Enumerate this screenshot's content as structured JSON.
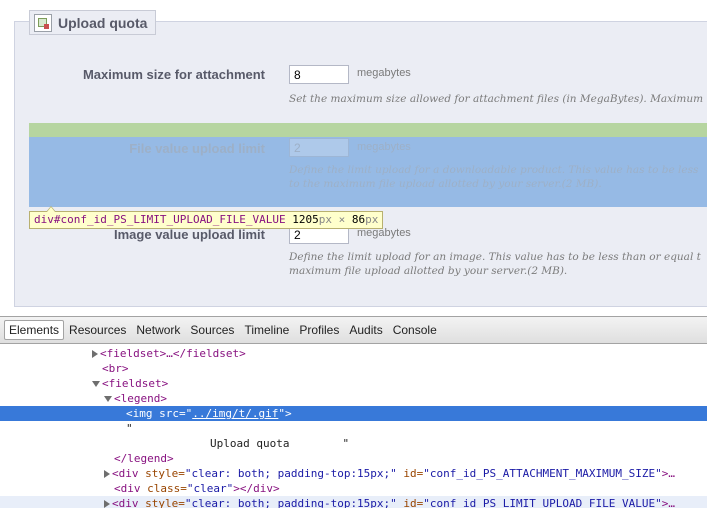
{
  "page": {
    "fieldset_legend": "Upload quota",
    "rows": [
      {
        "label": "Maximum size for attachment",
        "value": "8",
        "unit": "megabytes",
        "description": "Set the maximum size allowed for attachment files (in MegaBytes). Maximum"
      },
      {
        "label": "File value upload limit",
        "value": "2",
        "unit": "megabytes",
        "description_line1": "Define the limit upload for a downloadable product. This value has to be less",
        "description_line2": "to the maximum file upload allotted by your server.(2 MB)."
      },
      {
        "label": "Image value upload limit",
        "value": "2",
        "unit": "megabytes",
        "description_line1": "Define the limit upload for an image. This value has to be less than or equal t",
        "description_line2": "maximum file upload allotted by your server.(2 MB)."
      }
    ],
    "tooltip": {
      "selector": "div#conf_id_PS_LIMIT_UPLOAD_FILE_VALUE",
      "width": "1205",
      "height": "86",
      "unit": "px",
      "times": "×"
    }
  },
  "devtools": {
    "tabs": [
      "Elements",
      "Resources",
      "Network",
      "Sources",
      "Timeline",
      "Profiles",
      "Audits",
      "Console"
    ],
    "active_tab": "Elements",
    "dom_lines": {
      "l1": "<fieldset>…</fieldset>",
      "l2": "<br>",
      "l3": "<fieldset>",
      "l4": "<legend>",
      "l5_tag_open": "<img src=\"",
      "l5_src": "../img/t/.gif",
      "l5_tag_close": "\">",
      "l6": "\"",
      "l7": "Upload quota        \"",
      "l8": "</legend>",
      "l9_open": "<div ",
      "l9_a1": "style=",
      "l9_v1": "\"clear: both; padding-top:15px;\"",
      "l9_a2": " id=",
      "l9_v2": "\"conf_id_PS_ATTACHMENT_MAXIMUM_SIZE\"",
      "l9_close": ">…",
      "l10_open": "<div ",
      "l10_a1": "class=",
      "l10_v1": "\"clear\"",
      "l10_close": "></div>",
      "l11_open": "<div ",
      "l11_a1": "style=",
      "l11_v1": "\"clear: both; padding-top:15px;\"",
      "l11_a2": " id=",
      "l11_v2": "\"conf_id_PS_LIMIT_UPLOAD_FILE_VALUE\"",
      "l11_close": ">…"
    }
  }
}
